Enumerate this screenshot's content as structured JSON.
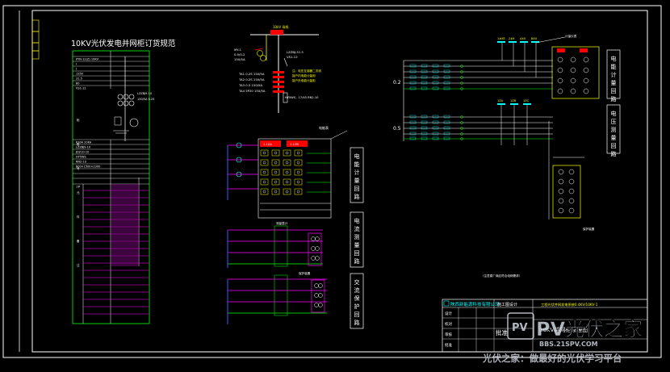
{
  "title_main": "10KV光伏发电并网柜订货规范",
  "spec_table_rows": [
    "KYN-12(Z) 10KV",
    "Ⅰ",
    "Ⅰ",
    "1250",
    "31.5",
    "80",
    "VS1-12",
    "630A 20KA",
    "LZZBJ9-10",
    "JDZ10-10",
    "HY5WS",
    "RN2-10",
    "800×1500×2300",
    "",
    "",
    "",
    "1#"
  ],
  "left_labels": [
    "柜",
    "型",
    "号",
    "元",
    "件",
    "备",
    "注"
  ],
  "riser": {
    "busbar": "10kV 母线",
    "lines": [
      "MY-1",
      "0.5/0.2",
      "150/5A"
    ],
    "ct": [
      "TA1  0.2S   150/5A",
      "TA2  0.2S   150/5A",
      "TA3  0.5   150/5A",
      "TA4  5P20  150/5A"
    ],
    "pt": [
      "LZZBJ-31.5",
      "VS1-12"
    ],
    "remark": "注：电压互感器二次线"
  },
  "meter_labels": {
    "top": [
      "1#XE",
      "2#X",
      "AXII",
      "BXII"
    ],
    "box": "计量仪表",
    "row_labels": [
      "0.2",
      "0.5"
    ],
    "bottom": [
      "1ZA",
      "1ZB",
      "1ZC"
    ],
    "relay": "保护装置",
    "note": "（注意原厂商应符合电网需求）"
  },
  "panel_titles": {
    "p1": "电能计量回路",
    "p2": "电流测量回路",
    "p3": "电压测量回路",
    "p4": "电能计量回路",
    "p5": "交流保护回路"
  },
  "mid_circuits": {
    "box_label": "电能表",
    "c1_head": [
      "1-1ZA",
      "1-1ZB"
    ],
    "c2_head": "测量表计",
    "c3_head": "保护装置"
  },
  "title_block": {
    "company": "陕西新能源科技有限公司",
    "drawing_kind": "施工图设计",
    "project": "工程光伏并网发电系统0.4KV/10KV-1",
    "drawing_title": "10KV并网柜原理图",
    "sign_rows": [
      "设计",
      "校对",
      "审核",
      "批准"
    ],
    "stamp": "批准"
  },
  "watermark": {
    "logo": "PV光伏之家",
    "url": "BBS.21SPV.COM",
    "slogan": "光伏之家：做最好的光伏学习平台"
  },
  "colors": {
    "background": "#000000",
    "frame": "#ffffff",
    "magenta": "#ff00ff",
    "green": "#00ff00",
    "cyan": "#00ffff",
    "yellow": "#ffff00",
    "red": "#ff0000",
    "blue": "#3a5cff"
  }
}
